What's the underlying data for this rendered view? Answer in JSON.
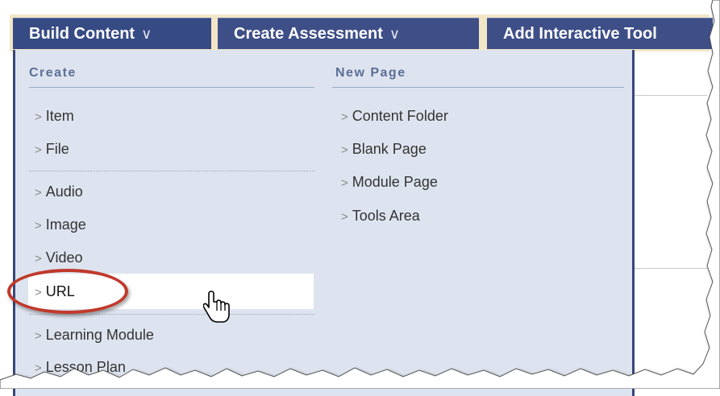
{
  "toolbar": {
    "tabs": [
      {
        "label": "Build Content",
        "chevron": "»"
      },
      {
        "label": "Create Assessment",
        "chevron": "»"
      },
      {
        "label": "Add Interactive Tool"
      }
    ]
  },
  "menu": {
    "create": {
      "heading": "Create",
      "items": [
        "Item",
        "File",
        "Audio",
        "Image",
        "Video",
        "URL",
        "Learning Module",
        "Lesson Plan"
      ]
    },
    "new_page": {
      "heading": "New Page",
      "items": [
        "Content Folder",
        "Blank Page",
        "Module Page",
        "Tools Area"
      ]
    },
    "arrow_glyph": ">"
  },
  "colors": {
    "toolbar_tab": "#3e4f88",
    "toolbar_bg": "#f2e6c6",
    "menu_bg": "#dee4ef",
    "heading": "#5b6e98",
    "highlight_ring": "#c0392b"
  },
  "icons": [
    "chevron-double-down-icon",
    "hand-pointer-cursor-icon"
  ]
}
